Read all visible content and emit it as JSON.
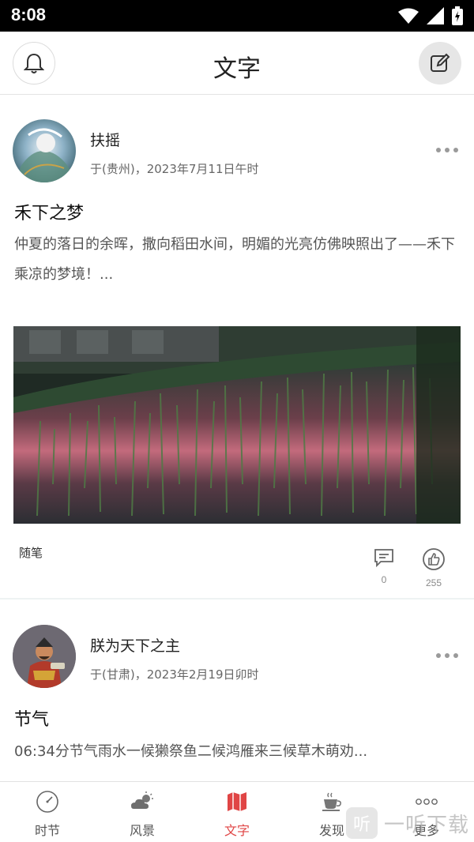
{
  "status_bar": {
    "time": "8:08"
  },
  "header": {
    "title": "文字"
  },
  "posts": [
    {
      "author": "扶摇",
      "meta": "于(贵州)，2023年7月11日午时",
      "title": "禾下之梦",
      "excerpt": "仲夏的落日的余晖，撒向稻田水间，明媚的光亮仿佛映照出了——禾下乘凉的梦境！...",
      "tag": "随笔",
      "comments": "0",
      "likes": "255"
    },
    {
      "author": "朕为天下之主",
      "meta": "于(甘肃)，2023年2月19日卯时",
      "title": "节气",
      "excerpt": "06:34分节气雨水一候獭祭鱼二候鸿雁来三候草木萌劝..."
    }
  ],
  "tabs": [
    {
      "label": "时节",
      "icon": "clock-icon"
    },
    {
      "label": "风景",
      "icon": "cloud-sun-icon"
    },
    {
      "label": "文字",
      "icon": "map-icon",
      "active": true
    },
    {
      "label": "发现",
      "icon": "coffee-cup-icon"
    },
    {
      "label": "更多",
      "icon": "more-dots-icon"
    }
  ],
  "watermark": {
    "badge": "听",
    "text": "一听下载"
  },
  "colors": {
    "accent": "#e04545",
    "status_bar": "#000000"
  }
}
